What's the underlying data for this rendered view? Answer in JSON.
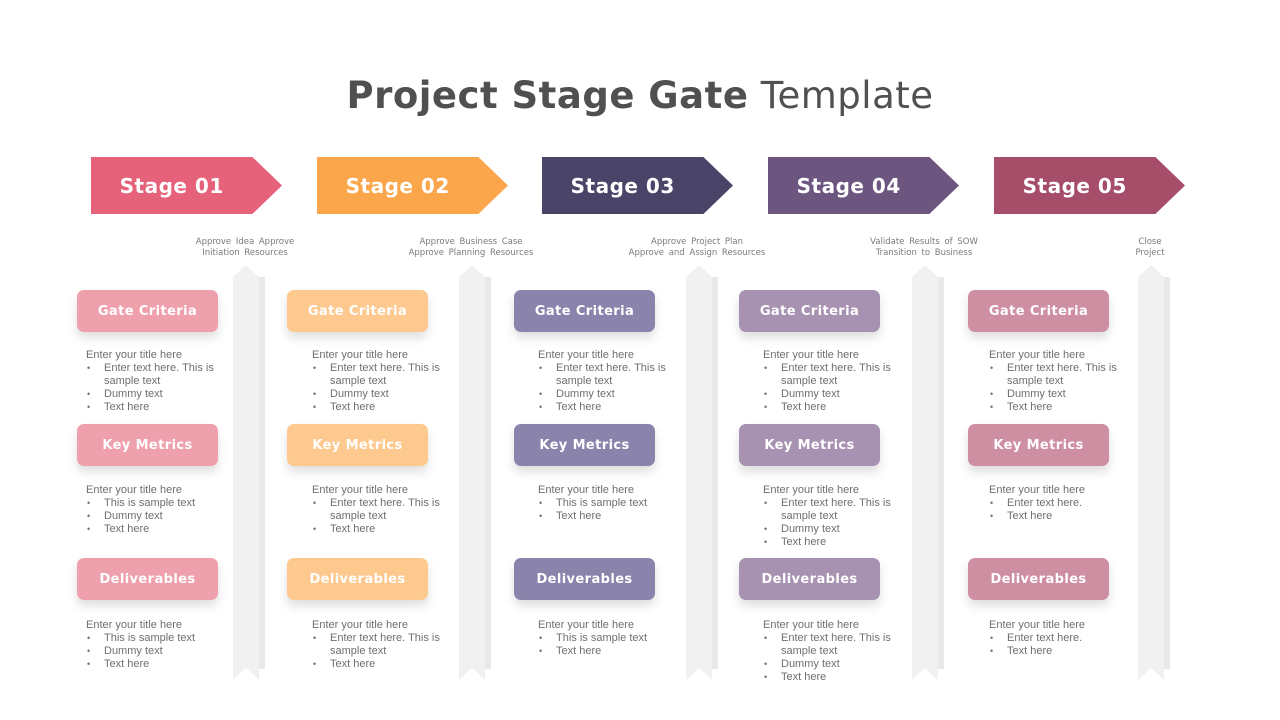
{
  "title": {
    "bold": "Project Stage Gate",
    "light": "Template"
  },
  "stages": [
    {
      "label": "Stage 01",
      "color": "#E6627A",
      "pill_color": "#EFA0AD",
      "gate_note": [
        "Approve Idea Approve",
        "Initiation Resources"
      ],
      "sections": [
        {
          "label": "Gate Criteria",
          "title": "Enter your title here",
          "bullets": [
            "Enter text here. This is sample text",
            "Dummy text",
            "Text here"
          ]
        },
        {
          "label": "Key Metrics",
          "title": "Enter your title here",
          "bullets": [
            "This is sample text",
            "Dummy text",
            "Text here"
          ]
        },
        {
          "label": "Deliverables",
          "title": "Enter your title here",
          "bullets": [
            "This is sample text",
            "Dummy text",
            "Text here"
          ]
        }
      ]
    },
    {
      "label": "Stage 02",
      "color": "#FBA64B",
      "pill_color": "#FDC98F",
      "gate_note": [
        "Approve Business Case",
        "Approve Planning Resources"
      ],
      "sections": [
        {
          "label": "Gate Criteria",
          "title": "Enter your title here",
          "bullets": [
            "Enter text here. This is sample text",
            "Dummy text",
            "Text here"
          ]
        },
        {
          "label": "Key Metrics",
          "title": "Enter your title here",
          "bullets": [
            "Enter text here. This is sample text",
            "Text here"
          ]
        },
        {
          "label": "Deliverables",
          "title": "Enter your title here",
          "bullets": [
            "Enter text here. This is sample text",
            "Text here"
          ]
        }
      ]
    },
    {
      "label": "Stage 03",
      "color": "#4A4468",
      "pill_color": "#8A84AC",
      "gate_note": [
        "Approve Project Plan",
        "Approve and Assign Resources"
      ],
      "sections": [
        {
          "label": "Gate Criteria",
          "title": "Enter your title here",
          "bullets": [
            "Enter text here. This is sample text",
            "Dummy text",
            "Text here"
          ]
        },
        {
          "label": "Key Metrics",
          "title": "Enter your title here",
          "bullets": [
            "This is sample text",
            "Text here"
          ]
        },
        {
          "label": "Deliverables",
          "title": "Enter your title here",
          "bullets": [
            "This is sample text",
            "Text here"
          ]
        }
      ]
    },
    {
      "label": "Stage 04",
      "color": "#6C5680",
      "pill_color": "#A892B2",
      "gate_note": [
        "Validate Results of SOW",
        "Transition to Business"
      ],
      "sections": [
        {
          "label": "Gate Criteria",
          "title": "Enter your title here",
          "bullets": [
            "Enter text here. This is sample text",
            "Dummy text",
            "Text here"
          ]
        },
        {
          "label": "Key Metrics",
          "title": "Enter your title here",
          "bullets": [
            "Enter text here. This is sample text",
            "Dummy text",
            "Text here"
          ]
        },
        {
          "label": "Deliverables",
          "title": "Enter your title here",
          "bullets": [
            "Enter text here. This is sample text",
            "Dummy text",
            "Text here"
          ]
        }
      ]
    },
    {
      "label": "Stage 05",
      "color": "#A64D6A",
      "pill_color": "#CE8FA2",
      "gate_note": [
        "Close",
        "Project"
      ],
      "sections": [
        {
          "label": "Gate Criteria",
          "title": "Enter your title here",
          "bullets": [
            "Enter text here. This is sample text",
            "Dummy text",
            "Text here"
          ]
        },
        {
          "label": "Key Metrics",
          "title": "Enter your title here",
          "bullets": [
            "Enter text here.",
            "Text here"
          ]
        },
        {
          "label": "Deliverables",
          "title": "Enter your title here",
          "bullets": [
            "Enter text here.",
            "Text here"
          ]
        }
      ]
    }
  ]
}
